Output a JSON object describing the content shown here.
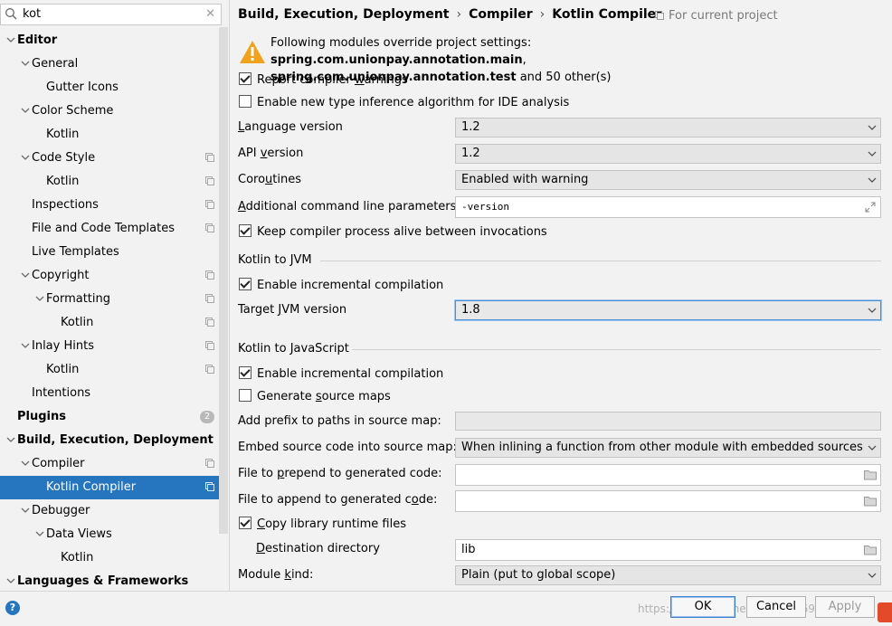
{
  "search": {
    "value": "kot"
  },
  "tree": [
    {
      "label": "Editor",
      "bold": true,
      "expanded": true
    },
    {
      "label": "General",
      "expanded": true
    },
    {
      "label": "Gutter Icons"
    },
    {
      "label": "Color Scheme",
      "expanded": true
    },
    {
      "label": "Kotlin"
    },
    {
      "label": "Code Style",
      "expanded": true,
      "copy": true
    },
    {
      "label": "Kotlin",
      "copy": true
    },
    {
      "label": "Inspections",
      "copy": true
    },
    {
      "label": "File and Code Templates",
      "copy": true
    },
    {
      "label": "Live Templates"
    },
    {
      "label": "Copyright",
      "expanded": true,
      "copy": true
    },
    {
      "label": "Formatting",
      "expanded": true,
      "copy": true
    },
    {
      "label": "Kotlin",
      "copy": true
    },
    {
      "label": "Inlay Hints",
      "expanded": true,
      "copy": true
    },
    {
      "label": "Kotlin",
      "copy": true
    },
    {
      "label": "Intentions"
    },
    {
      "label": "Plugins",
      "bold": true,
      "badge": "2"
    },
    {
      "label": "Build, Execution, Deployment",
      "bold": true,
      "expanded": true
    },
    {
      "label": "Compiler",
      "expanded": true,
      "copy": true
    },
    {
      "label": "Kotlin Compiler",
      "copy": true,
      "selected": true
    },
    {
      "label": "Debugger",
      "expanded": true
    },
    {
      "label": "Data Views",
      "expanded": true
    },
    {
      "label": "Kotlin"
    },
    {
      "label": "Languages & Frameworks",
      "bold": true,
      "expanded": true
    }
  ],
  "breadcrumb": [
    "Build, Execution, Deployment",
    "Compiler",
    "Kotlin Compiler"
  ],
  "for_project": "For current project",
  "warning": {
    "prefix": "Following modules override project settings: ",
    "module1": "spring.com.unionpay.annotation.main",
    "comma": ",",
    "module2": "spring.com.unionpay.annotation.test",
    "suffix": " and 50 other(s)"
  },
  "report_warnings": {
    "pre": "Report compiler ",
    "u": "w",
    "post": "arnings",
    "checked": true
  },
  "new_inference": {
    "label": "Enable new type inference algorithm for IDE analysis",
    "checked": false
  },
  "language_version": {
    "pre": "",
    "u": "L",
    "post": "anguage version",
    "value": "1.2"
  },
  "api_version": {
    "pre": "API ",
    "u": "v",
    "post": "ersion",
    "value": "1.2"
  },
  "coroutines": {
    "pre": "Coro",
    "u": "u",
    "post": "tines",
    "value": "Enabled with warning"
  },
  "additional_params": {
    "pre": "",
    "u": "A",
    "post": "dditional command line parameters:",
    "value": "-version"
  },
  "keep_alive": {
    "label": "Keep compiler process alive between invocations",
    "checked": true
  },
  "jvm_section": {
    "title": "Kotlin to JVM",
    "incremental": "Enable incremental compilation",
    "incremental_checked": true,
    "target_pre": "Target ",
    "target_u": "J",
    "target_post": "VM version",
    "target_value": "1.8"
  },
  "js_section": {
    "title": "Kotlin to JavaScript",
    "incremental": "Enable incremental compilation",
    "incremental_checked": true,
    "srcmaps_pre": "Generate ",
    "srcmaps_u": "s",
    "srcmaps_post": "ource maps",
    "srcmaps_checked": false,
    "prefix_label": "Add prefix to paths in source map:",
    "embed_label": "Embed source code into source map:",
    "embed_value": "When inlining a function from other module with embedded sources",
    "prepend_pre": "File to ",
    "prepend_u": "p",
    "prepend_post": "repend to generated code:",
    "append_pre": "File to append to generated c",
    "append_u": "o",
    "append_post": "de:",
    "copy_pre": "",
    "copy_u": "C",
    "copy_post": "opy library runtime files",
    "copy_checked": true,
    "dest_pre": "",
    "dest_u": "D",
    "dest_post": "estination directory",
    "dest_value": "lib",
    "module_pre": "Module ",
    "module_u": "k",
    "module_post": "ind:",
    "module_value": "Plain (put to global scope)"
  },
  "buttons": {
    "ok": "OK",
    "cancel": "Cancel",
    "apply": "Apply",
    "help": "?"
  },
  "watermark": "https://blog.csdn.net/weixin_36990041"
}
